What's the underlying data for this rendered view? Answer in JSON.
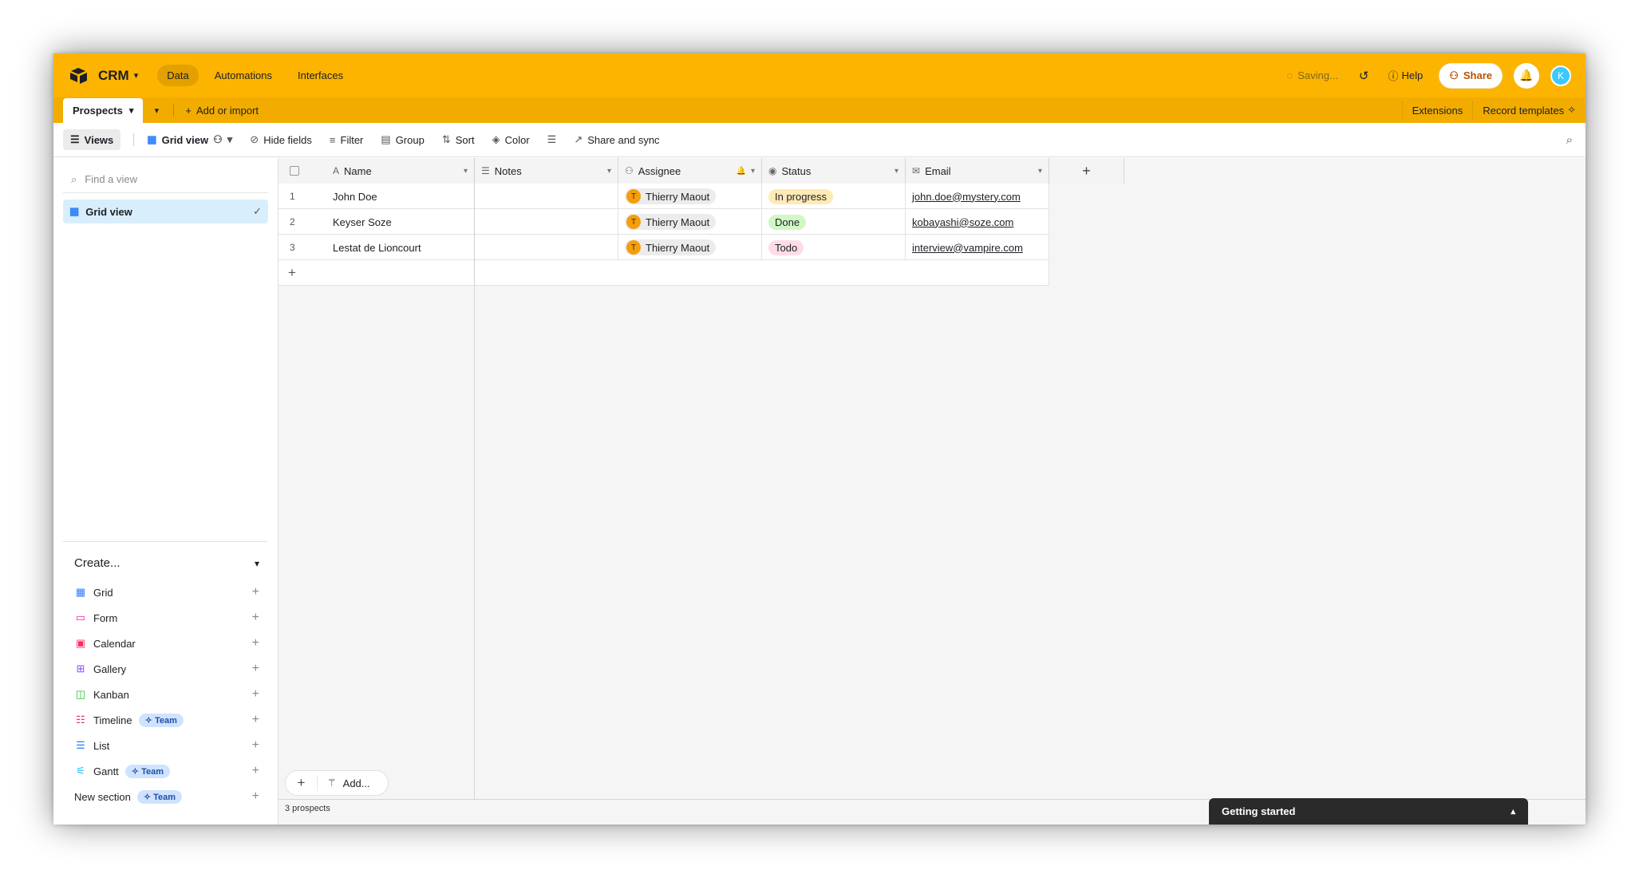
{
  "app": {
    "base_name": "CRM",
    "nav_tabs": [
      "Data",
      "Automations",
      "Interfaces"
    ],
    "saving": "Saving...",
    "help": "Help",
    "share": "Share",
    "avatar_letter": "K"
  },
  "tables": {
    "active": "Prospects",
    "add_import": "Add or import",
    "extensions": "Extensions",
    "record_templates": "Record templates"
  },
  "toolbar": {
    "views": "Views",
    "grid_view": "Grid view",
    "hide_fields": "Hide fields",
    "filter": "Filter",
    "group": "Group",
    "sort": "Sort",
    "color": "Color",
    "share_sync": "Share and sync"
  },
  "sidebar": {
    "find_placeholder": "Find a view",
    "active_view": "Grid view",
    "create_label": "Create...",
    "create_items": [
      {
        "label": "Grid",
        "icon": "grid-icon",
        "color": "#2d7ff9"
      },
      {
        "label": "Form",
        "icon": "form-icon",
        "color": "#e929ba"
      },
      {
        "label": "Calendar",
        "icon": "calendar-icon",
        "color": "#f82b60"
      },
      {
        "label": "Gallery",
        "icon": "gallery-icon",
        "color": "#8b46ff"
      },
      {
        "label": "Kanban",
        "icon": "kanban-icon",
        "color": "#20c933"
      },
      {
        "label": "Timeline",
        "icon": "timeline-icon",
        "color": "#f82b60",
        "badge": "Team"
      },
      {
        "label": "List",
        "icon": "list-icon",
        "color": "#2d7ff9"
      },
      {
        "label": "Gantt",
        "icon": "gantt-icon",
        "color": "#18bfff",
        "badge": "Team"
      }
    ],
    "new_section": "New section",
    "new_section_badge": "Team"
  },
  "grid": {
    "columns": [
      "Name",
      "Notes",
      "Assignee",
      "Status",
      "Email"
    ],
    "rows": [
      {
        "num": "1",
        "name": "John Doe",
        "notes": "",
        "assignee": "Thierry Maout",
        "assignee_initial": "T",
        "status": "In progress",
        "status_color": "#ffeab6",
        "email": "john.doe@mystery.com"
      },
      {
        "num": "2",
        "name": "Keyser Soze",
        "notes": "",
        "assignee": "Thierry Maout",
        "assignee_initial": "T",
        "status": "Done",
        "status_color": "#d1f7c4",
        "email": "kobayashi@soze.com"
      },
      {
        "num": "3",
        "name": "Lestat de Lioncourt",
        "notes": "",
        "assignee": "Thierry Maout",
        "assignee_initial": "T",
        "status": "Todo",
        "status_color": "#ffdce5",
        "email": "interview@vampire.com"
      }
    ],
    "record_count": "3 prospects",
    "add_label": "Add..."
  },
  "getting_started": "Getting started",
  "colors": {
    "brand": "#fcb400",
    "accent_share": "#b45309"
  }
}
